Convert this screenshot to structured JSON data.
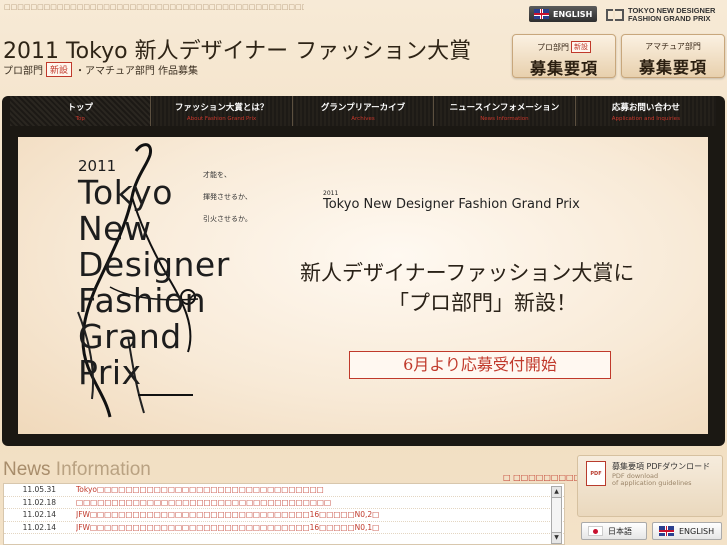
{
  "top_banner": "□□□□□□□□□□□□□□□□□□□□□□□□□□□□□□□□□□□□□□□□□□□□□□□□□□□□□□□□□□",
  "header": {
    "english_label": "ENGLISH",
    "brand_line1": "TOKYO NEW DESIGNER",
    "brand_line2": "FASHION GRAND PRIX",
    "title": "2011 Tokyo 新人デザイナー ファッション大賞",
    "subtitle_pre": "プロ部門",
    "subtitle_new": "新設",
    "subtitle_post": "・アマチュア部門 作品募集"
  },
  "recruit_buttons": [
    {
      "category": "プロ部門",
      "new": "新設",
      "label": "募集要項"
    },
    {
      "category": "アマチュア部門",
      "new": "",
      "label": "募集要項"
    }
  ],
  "nav": [
    {
      "ja": "トップ",
      "en": "Top"
    },
    {
      "ja": "ファッション大賞とは？",
      "en": "About Fashion Grand Prix"
    },
    {
      "ja": "グランプリアーカイブ",
      "en": "Archives"
    },
    {
      "ja": "ニュースインフォメーション",
      "en": "News Information"
    },
    {
      "ja": "応募お問い合わせ",
      "en": "Application and Inquiries"
    }
  ],
  "hero": {
    "year": "2011",
    "words": [
      "Tokyo",
      "New",
      "Designer",
      "Fashion",
      "Grand",
      "Prix"
    ],
    "tagline": [
      "才能を、",
      "揮発させるか、",
      "引火させるか。"
    ],
    "en_year": "2011",
    "en_title": "Tokyo New Designer Fashion Grand Prix",
    "jp_line1": "新人デザイナーファッション大賞に",
    "jp_line2": "「プロ部門」新設！",
    "cta": "6月より応募受付開始"
  },
  "news": {
    "heading_1": "News",
    "heading_2": " Information",
    "more_link": "□ □□□□□□□□□□□□□",
    "items": [
      {
        "date": "11.05.31",
        "text": "Tokyo□□□□□□□□□□□□□□□□□□□□□□□□□□□□□□□□"
      },
      {
        "date": "11.02.18",
        "text": "□□□□□□□□□□□□□□□□□□□□□□□□□□□□□□□□□□□□"
      },
      {
        "date": "11.02.14",
        "text": "JFW□□□□□□□□□□□□□□□□□□□□□□□□□□□□□□□16□□□□□N0,2□"
      },
      {
        "date": "11.02.14",
        "text": "JFW□□□□□□□□□□□□□□□□□□□□□□□□□□□□□□□16□□□□□N0,1□"
      }
    ]
  },
  "pdf": {
    "title": "募集要項 PDFダウンロード",
    "sub1": "PDF download",
    "sub2": "of application guidelines"
  },
  "language": {
    "japanese": "日本語",
    "english": "ENGLISH"
  }
}
